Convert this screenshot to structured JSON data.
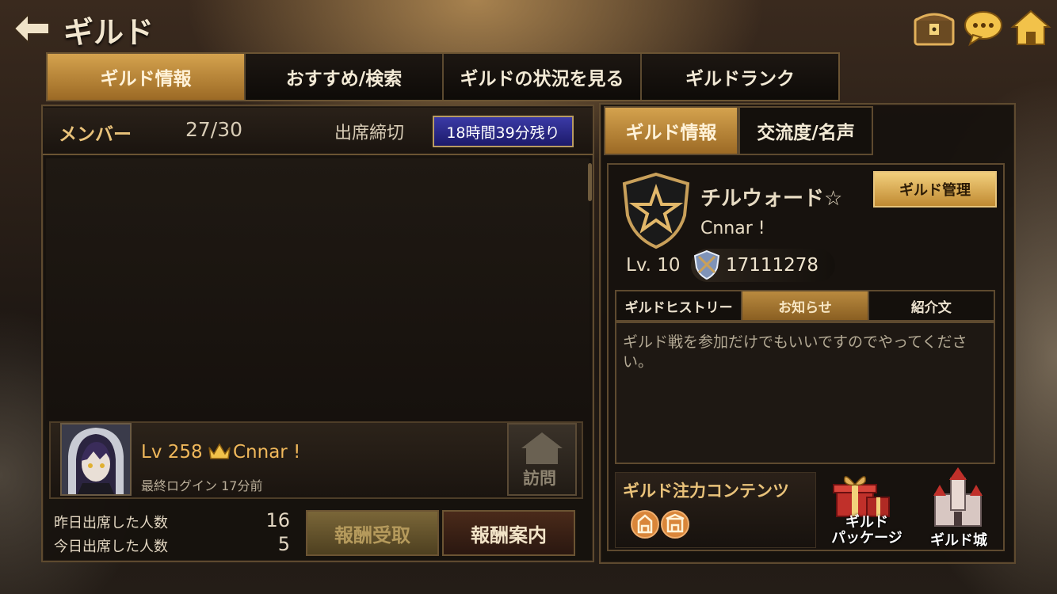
{
  "header": {
    "title": "ギルド",
    "back_icon": "back-arrow-icon",
    "icons": [
      "treasure-chest-icon",
      "chat-bubble-icon",
      "home-icon"
    ]
  },
  "main_tabs": [
    {
      "label": "ギルド情報",
      "active": true
    },
    {
      "label": "おすすめ/検索",
      "active": false
    },
    {
      "label": "ギルドの状況を見る",
      "active": false
    },
    {
      "label": "ギルドランク",
      "active": false
    }
  ],
  "members": {
    "label": "メンバー",
    "count": "27/30",
    "deadline_label": "出席締切",
    "deadline_remaining": "18時間39分残り",
    "list": [
      {
        "level": "Lv 258",
        "name": "Cnnar !",
        "last_login": "最終ログイン  17分前",
        "visit_label": "訪問"
      }
    ]
  },
  "attendance": {
    "yesterday_label": "昨日出席した人数",
    "yesterday_count": "16",
    "today_label": "今日出席した人数",
    "today_count": "5",
    "claim_label": "報酬受取",
    "guide_label": "報酬案内"
  },
  "sub_tabs": [
    {
      "label": "ギルド情報",
      "active": true
    },
    {
      "label": "交流度/名声",
      "active": false
    }
  ],
  "guild": {
    "name": "チルウォード☆",
    "leader": "Cnnar !",
    "manage_label": "ギルド管理",
    "level": "Lv. 10",
    "power": "17111278",
    "info_tabs": [
      {
        "label": "ギルドヒストリー",
        "active": false
      },
      {
        "label": "お知らせ",
        "active": true
      },
      {
        "label": "紹介文",
        "active": false
      }
    ],
    "notice": "ギルド戦を参加だけでもいいですのでやってください。",
    "focus_label": "ギルド注力コンテンツ",
    "package_label_line1": "ギルド",
    "package_label_line2": "パッケージ",
    "castle_label": "ギルド城"
  },
  "colors": {
    "accent_gold": "#d4a24e",
    "deadline_badge": "#3b3aa6",
    "text_gold": "#f0b85b"
  }
}
